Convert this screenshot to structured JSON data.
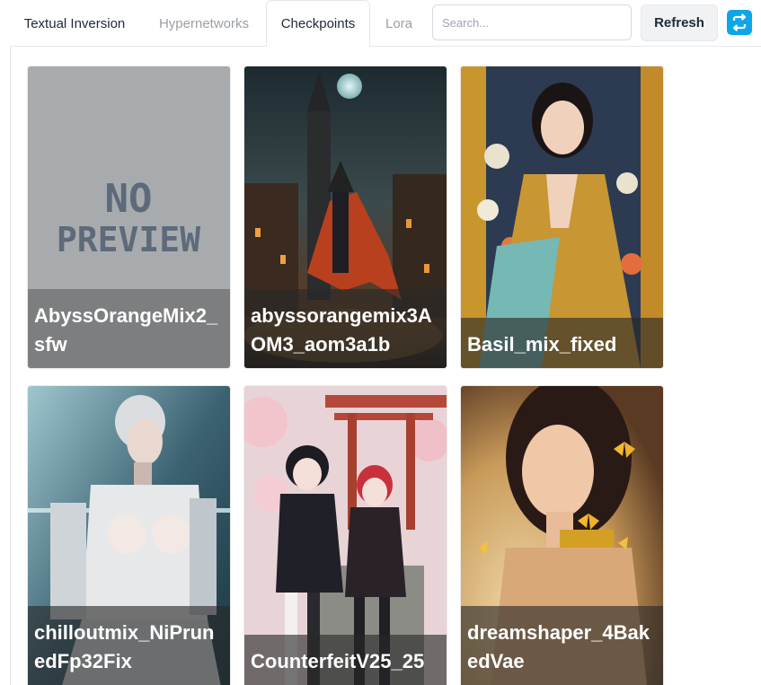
{
  "tabs": [
    {
      "label": "Textual Inversion",
      "state": "normal"
    },
    {
      "label": "Hypernetworks",
      "state": "inactive"
    },
    {
      "label": "Checkpoints",
      "state": "active"
    },
    {
      "label": "Lora",
      "state": "inactive"
    }
  ],
  "search": {
    "placeholder": "Search...",
    "value": ""
  },
  "refresh_label": "Refresh",
  "sync_icon": "sync-arrows-icon",
  "accent_color": "#0ea5e9",
  "cards": [
    {
      "name": "AbyssOrangeMix2_sfw",
      "preview": "no-preview"
    },
    {
      "name": "abyssorangemix3AOM3_aom3a1b",
      "preview": "night-witch-scene"
    },
    {
      "name": "Basil_mix_fixed",
      "preview": "kimono-portrait"
    },
    {
      "name": "chilloutmix_NiPrunedFp32Fix",
      "preview": "cyborg-portrait"
    },
    {
      "name": "CounterfeitV25_25",
      "preview": "torii-gate-girls"
    },
    {
      "name": "dreamshaper_4BakedVae",
      "preview": "butterfly-portrait"
    }
  ],
  "no_preview_text": [
    "NO",
    "PREVIEW"
  ]
}
